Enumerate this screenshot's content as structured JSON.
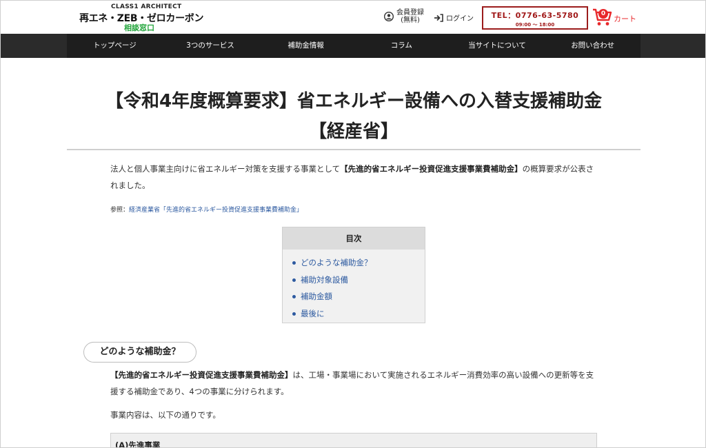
{
  "header": {
    "logo_top": "CLASS1 ARCHITECT",
    "logo_main": "再エネ・ZEB・ゼロカーボン",
    "logo_sub": "相談窓口",
    "register_label_1": "会員登録",
    "register_label_2": "(無料)",
    "login_label": "ログイン",
    "tel": "TEL：0776-63-5780",
    "hours": "09:00 〜 18:00",
    "cart_count": "0",
    "cart_label": "カート"
  },
  "nav": {
    "items": [
      {
        "label": "トップページ"
      },
      {
        "label": "3つのサービス"
      },
      {
        "label": "補助金情報"
      },
      {
        "label": "コラム"
      },
      {
        "label": "当サイトについて"
      },
      {
        "label": "お問い合わせ"
      }
    ]
  },
  "article": {
    "title_line1": "【令和4年度概算要求】省エネルギー設備への入替支援補助金",
    "title_line2": "【経産省】",
    "intro_pre": "法人と個人事業主向けに省エネルギー対策を支援する事業として",
    "intro_bold": "【先進的省エネルギー投資促進支援事業費補助金】",
    "intro_post": "の概算要求が公表されました。",
    "ref_label": "参照：",
    "ref_link": "経済産業省「先進的省エネルギー投資促進支援事業費補助金」",
    "toc_title": "目次",
    "toc_items": [
      {
        "label": "どのような補助金？"
      },
      {
        "label": "補助対象設備"
      },
      {
        "label": "補助金額"
      },
      {
        "label": "最後に"
      }
    ],
    "section1_heading": "どのような補助金？",
    "section1_bold": "【先進的省エネルギー投資促進支援事業費補助金】",
    "section1_text": "は、工場・事業場において実施されるエネルギー消費効率の高い設備への更新等を支援する補助金であり、4つの事業に分けられます。",
    "section1_note": "事業内容は、以下の通りです。",
    "box_a_heading": "(A)先進事業"
  },
  "colors": {
    "nav_bg": "#1e1e1e",
    "tel_border": "#9b1b1b",
    "cart_red": "#e8282b",
    "logo_green": "#23a53c",
    "link_blue": "#2d5aa0"
  }
}
